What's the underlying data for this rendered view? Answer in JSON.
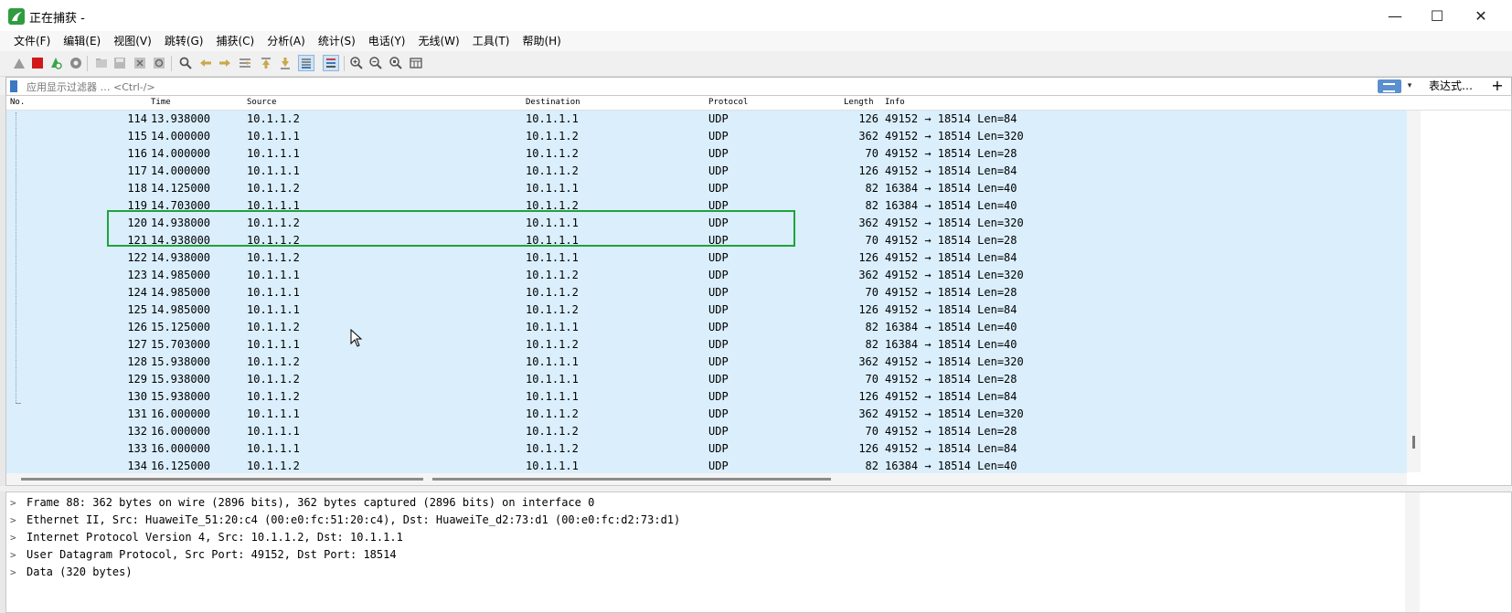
{
  "window": {
    "title": "正在捕获 -",
    "minimize": "—",
    "maximize": "☐",
    "close": "✕"
  },
  "menu": [
    "文件(F)",
    "编辑(E)",
    "视图(V)",
    "跳转(G)",
    "捕获(C)",
    "分析(A)",
    "统计(S)",
    "电话(Y)",
    "无线(W)",
    "工具(T)",
    "帮助(H)"
  ],
  "toolbar": {
    "icons": [
      "shark-fin-icon",
      "stop-icon",
      "restart-icon",
      "options-icon",
      "open-icon",
      "save-icon",
      "close-file-icon",
      "reload-icon",
      "find-icon",
      "back-icon",
      "forward-icon",
      "goto-icon",
      "first-icon",
      "last-icon",
      "autoscroll-icon",
      "colorize-icon",
      "zoom-in-icon",
      "zoom-out-icon",
      "zoom-normal-icon",
      "resize-columns-icon"
    ],
    "colors": {
      "stop": "#d11818",
      "restart": "#3aa64a",
      "accent": "#3a78c3"
    }
  },
  "filter": {
    "placeholder": "应用显示过滤器 … <Ctrl-/>",
    "expression_label": "表达式…",
    "plus_label": "+",
    "dropdown_glyph": "▾"
  },
  "packet_list": {
    "columns": [
      "No.",
      "Time",
      "Source",
      "Destination",
      "Protocol",
      "Length",
      "Info"
    ],
    "row_color": "#daeefc",
    "highlight_color": "#1fa33a",
    "rows": [
      {
        "no": "114",
        "time": "13.938000",
        "src": "10.1.1.2",
        "dst": "10.1.1.1",
        "proto": "UDP",
        "len": "126",
        "info": "49152 → 18514 Len=84"
      },
      {
        "no": "115",
        "time": "14.000000",
        "src": "10.1.1.1",
        "dst": "10.1.1.2",
        "proto": "UDP",
        "len": "362",
        "info": "49152 → 18514 Len=320"
      },
      {
        "no": "116",
        "time": "14.000000",
        "src": "10.1.1.1",
        "dst": "10.1.1.2",
        "proto": "UDP",
        "len": "70",
        "info": "49152 → 18514 Len=28"
      },
      {
        "no": "117",
        "time": "14.000000",
        "src": "10.1.1.1",
        "dst": "10.1.1.2",
        "proto": "UDP",
        "len": "126",
        "info": "49152 → 18514 Len=84"
      },
      {
        "no": "118",
        "time": "14.125000",
        "src": "10.1.1.2",
        "dst": "10.1.1.1",
        "proto": "UDP",
        "len": "82",
        "info": "16384 → 18514 Len=40"
      },
      {
        "no": "119",
        "time": "14.703000",
        "src": "10.1.1.1",
        "dst": "10.1.1.2",
        "proto": "UDP",
        "len": "82",
        "info": "16384 → 18514 Len=40"
      },
      {
        "no": "120",
        "time": "14.938000",
        "src": "10.1.1.2",
        "dst": "10.1.1.1",
        "proto": "UDP",
        "len": "362",
        "info": "49152 → 18514 Len=320"
      },
      {
        "no": "121",
        "time": "14.938000",
        "src": "10.1.1.2",
        "dst": "10.1.1.1",
        "proto": "UDP",
        "len": "70",
        "info": "49152 → 18514 Len=28"
      },
      {
        "no": "122",
        "time": "14.938000",
        "src": "10.1.1.2",
        "dst": "10.1.1.1",
        "proto": "UDP",
        "len": "126",
        "info": "49152 → 18514 Len=84"
      },
      {
        "no": "123",
        "time": "14.985000",
        "src": "10.1.1.1",
        "dst": "10.1.1.2",
        "proto": "UDP",
        "len": "362",
        "info": "49152 → 18514 Len=320"
      },
      {
        "no": "124",
        "time": "14.985000",
        "src": "10.1.1.1",
        "dst": "10.1.1.2",
        "proto": "UDP",
        "len": "70",
        "info": "49152 → 18514 Len=28"
      },
      {
        "no": "125",
        "time": "14.985000",
        "src": "10.1.1.1",
        "dst": "10.1.1.2",
        "proto": "UDP",
        "len": "126",
        "info": "49152 → 18514 Len=84"
      },
      {
        "no": "126",
        "time": "15.125000",
        "src": "10.1.1.2",
        "dst": "10.1.1.1",
        "proto": "UDP",
        "len": "82",
        "info": "16384 → 18514 Len=40"
      },
      {
        "no": "127",
        "time": "15.703000",
        "src": "10.1.1.1",
        "dst": "10.1.1.2",
        "proto": "UDP",
        "len": "82",
        "info": "16384 → 18514 Len=40"
      },
      {
        "no": "128",
        "time": "15.938000",
        "src": "10.1.1.2",
        "dst": "10.1.1.1",
        "proto": "UDP",
        "len": "362",
        "info": "49152 → 18514 Len=320"
      },
      {
        "no": "129",
        "time": "15.938000",
        "src": "10.1.1.2",
        "dst": "10.1.1.1",
        "proto": "UDP",
        "len": "70",
        "info": "49152 → 18514 Len=28"
      },
      {
        "no": "130",
        "time": "15.938000",
        "src": "10.1.1.2",
        "dst": "10.1.1.1",
        "proto": "UDP",
        "len": "126",
        "info": "49152 → 18514 Len=84"
      },
      {
        "no": "131",
        "time": "16.000000",
        "src": "10.1.1.1",
        "dst": "10.1.1.2",
        "proto": "UDP",
        "len": "362",
        "info": "49152 → 18514 Len=320"
      },
      {
        "no": "132",
        "time": "16.000000",
        "src": "10.1.1.1",
        "dst": "10.1.1.2",
        "proto": "UDP",
        "len": "70",
        "info": "49152 → 18514 Len=28"
      },
      {
        "no": "133",
        "time": "16.000000",
        "src": "10.1.1.1",
        "dst": "10.1.1.2",
        "proto": "UDP",
        "len": "126",
        "info": "49152 → 18514 Len=84"
      },
      {
        "no": "134",
        "time": "16.125000",
        "src": "10.1.1.2",
        "dst": "10.1.1.1",
        "proto": "UDP",
        "len": "82",
        "info": "16384 → 18514 Len=40"
      }
    ]
  },
  "details": {
    "chevron": ">",
    "lines": [
      "Frame 88: 362 bytes on wire (2896 bits), 362 bytes captured (2896 bits) on interface 0",
      "Ethernet II, Src: HuaweiTe_51:20:c4 (00:e0:fc:51:20:c4), Dst: HuaweiTe_d2:73:d1 (00:e0:fc:d2:73:d1)",
      "Internet Protocol Version 4, Src: 10.1.1.2, Dst: 10.1.1.1",
      "User Datagram Protocol, Src Port: 49152, Dst Port: 18514",
      "Data (320 bytes)"
    ]
  }
}
